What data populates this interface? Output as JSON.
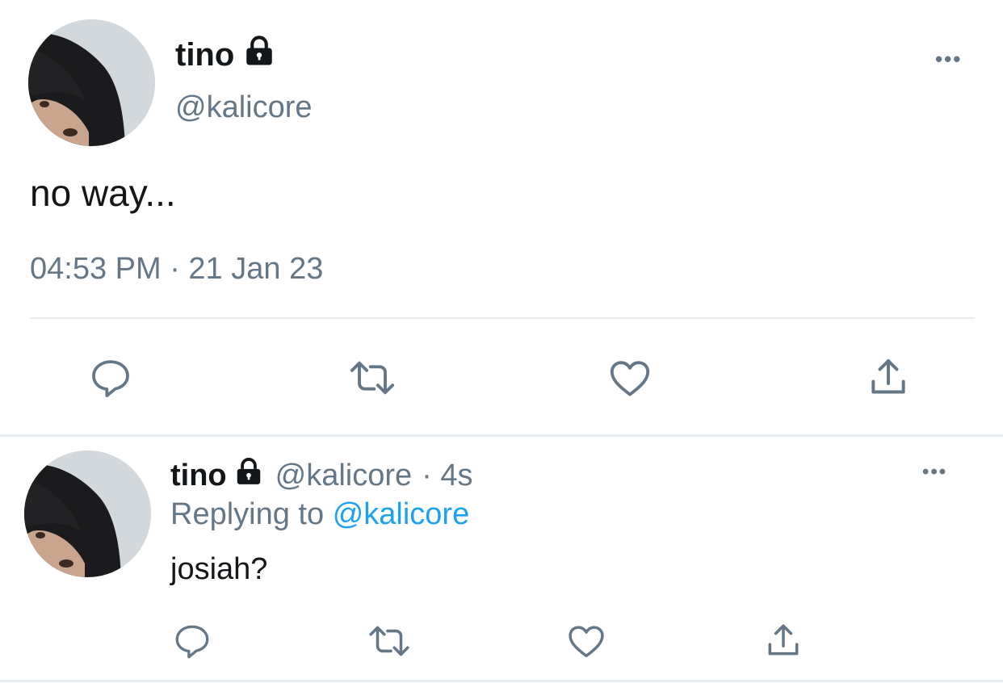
{
  "main_tweet": {
    "display_name": "tino",
    "handle": "@kalicore",
    "text": "no way...",
    "timestamp": "04:53 PM · 21 Jan 23",
    "more_label": "•••",
    "icons": {
      "lock": "lock-icon",
      "reply": "reply-icon",
      "retweet": "retweet-icon",
      "like": "heart-icon",
      "share": "share-icon"
    }
  },
  "reply_tweet": {
    "display_name": "tino",
    "handle": "@kalicore",
    "time": "· 4s",
    "replying_prefix": "Replying to",
    "replying_to": "@kalicore",
    "text": "josiah?",
    "more_label": "•••"
  },
  "colors": {
    "text": "#14171a",
    "muted": "#657786",
    "link": "#1da1f2",
    "divider": "#e6ecf0"
  }
}
